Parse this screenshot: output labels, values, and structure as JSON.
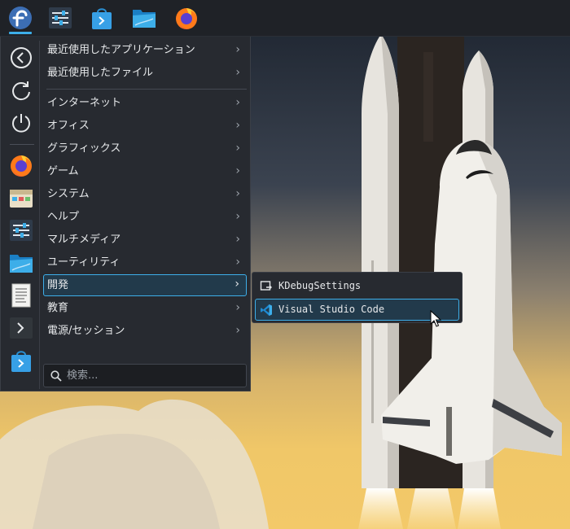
{
  "colors": {
    "accent": "#3daee9",
    "panel_bg": "#1f2227",
    "menu_bg": "#272a30",
    "selected_bg": "#223a4b"
  },
  "panel": {
    "launchers": [
      {
        "icon": "fedora-logo-icon"
      },
      {
        "icon": "system-settings-icon"
      },
      {
        "icon": "discover-store-icon"
      },
      {
        "icon": "file-manager-icon"
      },
      {
        "icon": "firefox-icon"
      }
    ]
  },
  "menu": {
    "favorites": [
      {
        "icon": "back-arrow-icon"
      },
      {
        "icon": "refresh-icon"
      },
      {
        "icon": "power-icon"
      },
      {
        "icon": "firefox-icon"
      },
      {
        "icon": "archive-manager-icon"
      },
      {
        "icon": "system-settings-icon"
      },
      {
        "icon": "file-manager-icon"
      },
      {
        "icon": "text-editor-icon"
      },
      {
        "icon": "terminal-icon"
      },
      {
        "icon": "discover-store-icon"
      }
    ],
    "recent": [
      {
        "label": "最近使用したアプリケーション"
      },
      {
        "label": "最近使用したファイル"
      }
    ],
    "categories": [
      {
        "label": "インターネット"
      },
      {
        "label": "オフィス"
      },
      {
        "label": "グラフィックス"
      },
      {
        "label": "ゲーム"
      },
      {
        "label": "システム"
      },
      {
        "label": "ヘルプ"
      },
      {
        "label": "マルチメディア"
      },
      {
        "label": "ユーティリティ"
      },
      {
        "label": "開発",
        "selected": true
      },
      {
        "label": "教育"
      },
      {
        "label": "電源/セッション"
      }
    ],
    "search": {
      "placeholder": "検索...",
      "value": ""
    }
  },
  "submenu": {
    "items": [
      {
        "label": "KDebugSettings",
        "icon": "kdebugsettings-icon"
      },
      {
        "label": "Visual Studio Code",
        "icon": "vscode-icon",
        "hover": true
      }
    ]
  }
}
